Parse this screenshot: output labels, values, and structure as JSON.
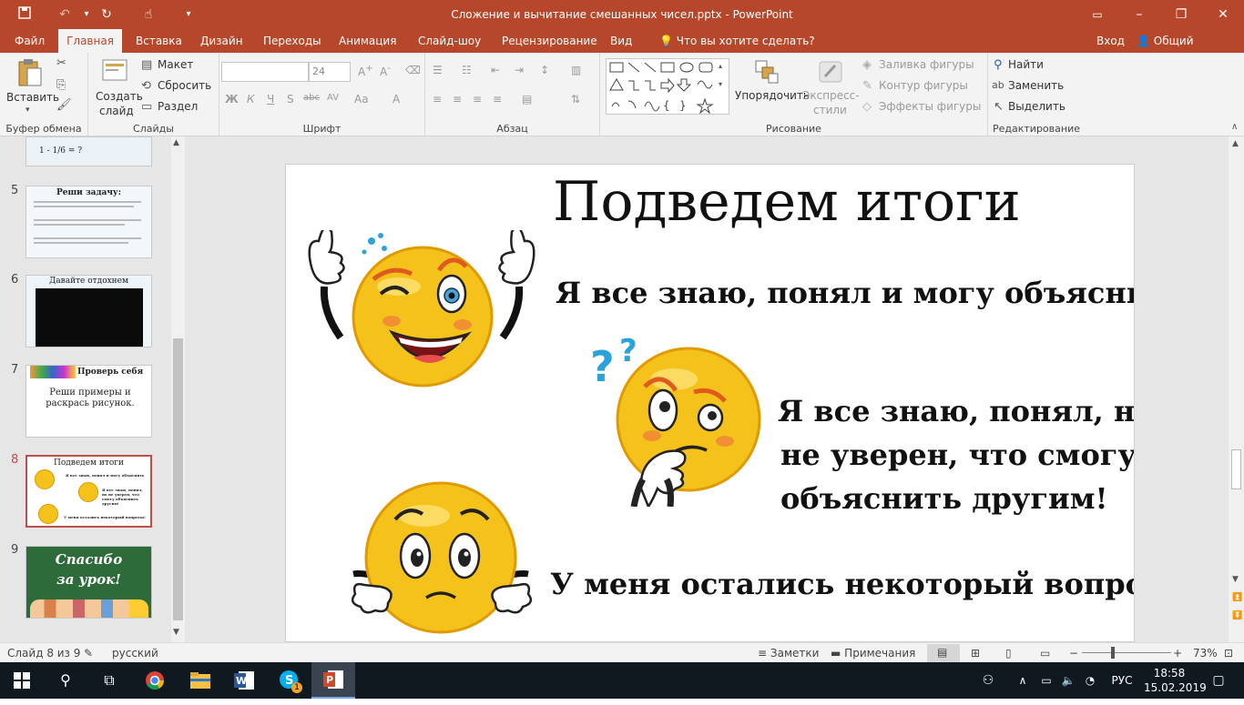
{
  "window": {
    "title": "Сложение и вычитание смешанных чисел.pptx - PowerPoint",
    "quick_access": {
      "save": "save-icon",
      "undo": "undo-icon",
      "redo": "redo-icon",
      "touch": "touch-mode-icon",
      "more": "more-icon"
    },
    "controls": {
      "ribbon_display": "ribbon-display-icon",
      "minimize": "–",
      "restore": "❐",
      "close": "✕"
    }
  },
  "tabs": [
    {
      "label": "Файл",
      "active": false
    },
    {
      "label": "Главная",
      "active": true
    },
    {
      "label": "Вставка",
      "active": false
    },
    {
      "label": "Дизайн",
      "active": false
    },
    {
      "label": "Переходы",
      "active": false
    },
    {
      "label": "Анимация",
      "active": false
    },
    {
      "label": "Слайд-шоу",
      "active": false
    },
    {
      "label": "Рецензирование",
      "active": false
    },
    {
      "label": "Вид",
      "active": false
    }
  ],
  "tell_me": "Что вы хотите сделать?",
  "signin": "Вход",
  "share": "Общий доступ",
  "ribbon": {
    "clipboard": {
      "paste": "Вставить",
      "label": "Буфер обмена"
    },
    "slides": {
      "new_slide_1": "Создать",
      "new_slide_2": "слайд",
      "layout": "Макет",
      "reset": "Сбросить",
      "section": "Раздел",
      "label": "Слайды"
    },
    "font": {
      "name": "",
      "size": "24",
      "bold": "Ж",
      "italic": "К",
      "underline": "Ч",
      "shadow": "S",
      "strike": "abc",
      "spacing": "AV",
      "case": "Aa",
      "color": "A",
      "label": "Шрифт"
    },
    "paragraph": {
      "label": "Абзац"
    },
    "drawing": {
      "arrange": "Упорядочить",
      "styles_1": "Экспресс-",
      "styles_2": "стили",
      "fill": "Заливка фигуры",
      "outline": "Контур фигуры",
      "effects": "Эффекты фигуры",
      "label": "Рисование"
    },
    "editing": {
      "find": "Найти",
      "replace": "Заменить",
      "select": "Выделить",
      "label": "Редактирование"
    }
  },
  "thumbnails": [
    {
      "num": "",
      "title": "1 - 1/6 = ?"
    },
    {
      "num": "5",
      "title": "Реши задачу:"
    },
    {
      "num": "6",
      "title": "Давайте отдохнем"
    },
    {
      "num": "7",
      "title": "Проверь себя",
      "body": "Реши примеры и раскрась рисунок."
    },
    {
      "num": "8",
      "title": "Подведем итоги",
      "line1": "Я все знаю, понял и могу объяснить",
      "line2": "Я все знаю, понял, но не уверен, что смогу объяснить другим!",
      "line3": "У меня остались некоторый вопросы!"
    },
    {
      "num": "9",
      "title": "Спасибо",
      "title2": "за урок!"
    }
  ],
  "slide": {
    "title": "Подведем итоги",
    "line1": "Я все знаю, понял и могу объяснить",
    "line2a": "Я все знаю, понял, но",
    "line2b": "не уверен, что смогу",
    "line2c": "объяснить другим!",
    "line3": "У меня остались некоторый вопросы!"
  },
  "status": {
    "slide_info": "Слайд 8 из 9",
    "language": "русский",
    "notes": "Заметки",
    "comments": "Примечания",
    "zoom": "73%",
    "zoom_level": 73
  },
  "taskbar": {
    "time": "18:58",
    "date": "15.02.2019",
    "lang": "РУС",
    "skype_badge": "1"
  },
  "colors": {
    "accent": "#b7472a",
    "taskbar": "#101820",
    "selected_thumb": "#c0504d"
  }
}
